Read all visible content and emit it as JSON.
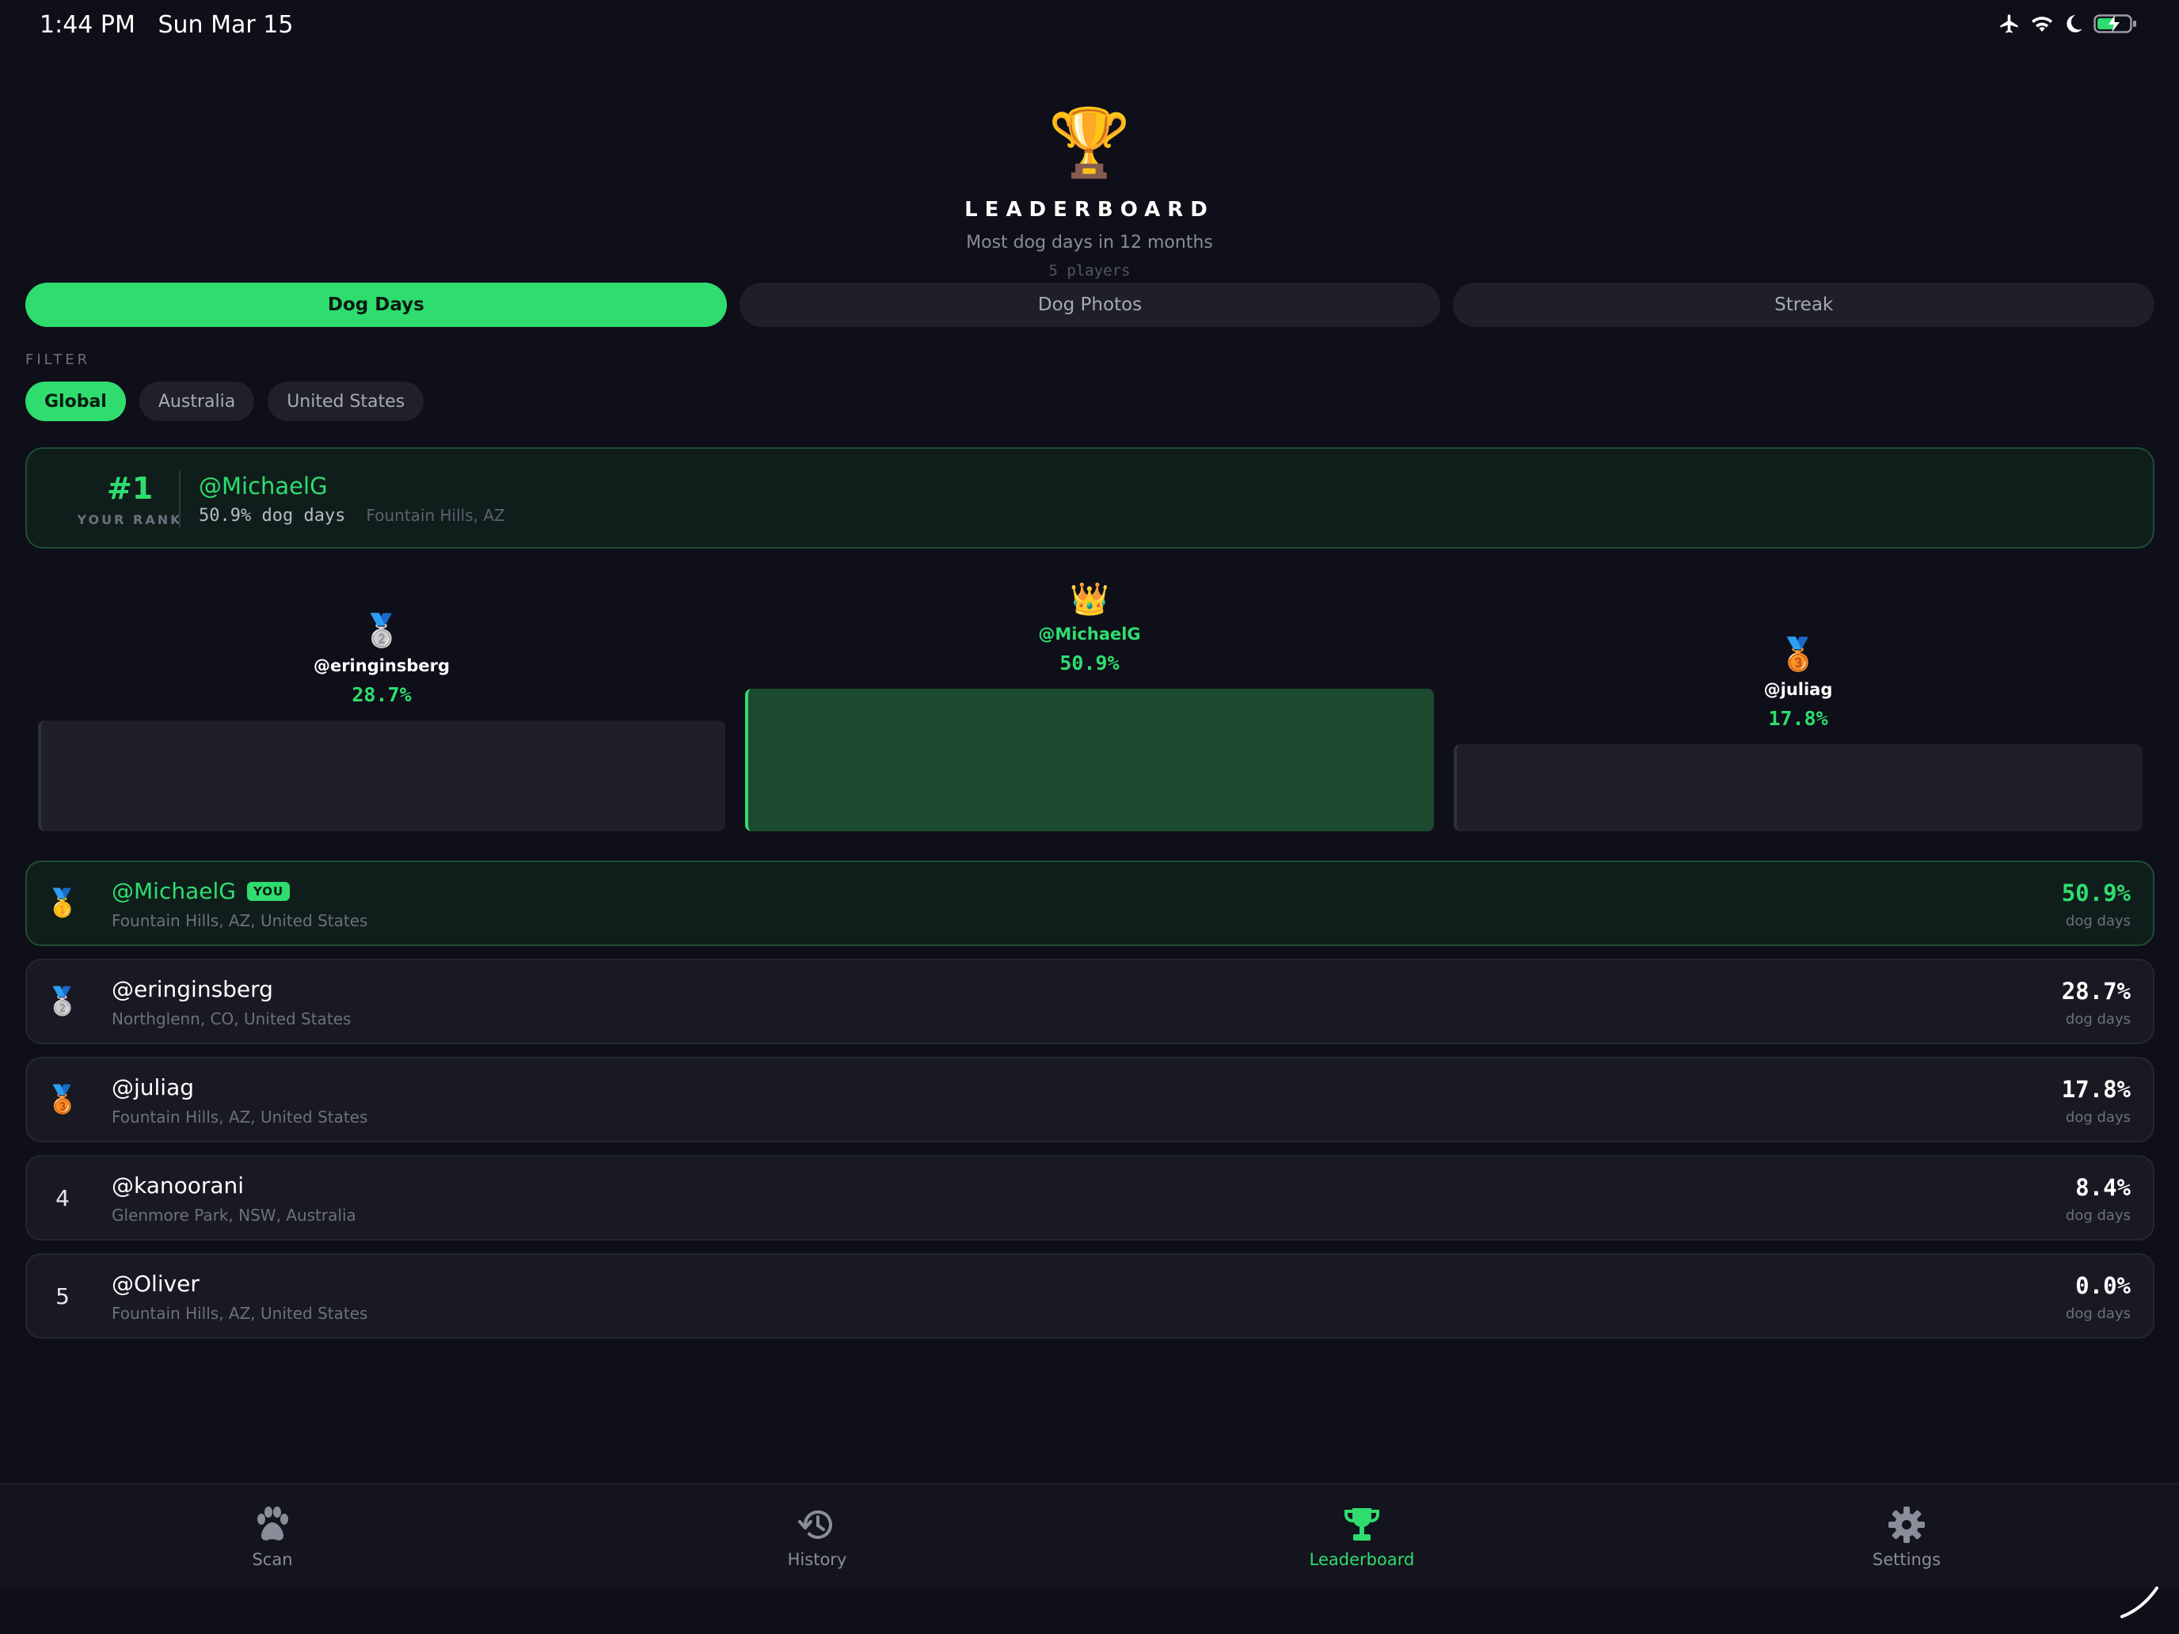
{
  "status_bar": {
    "time": "1:44 PM",
    "date": "Sun Mar 15"
  },
  "header": {
    "title": "LEADERBOARD",
    "subtitle": "Most dog days in 12 months",
    "player_count": "5 players"
  },
  "metric_tabs": [
    {
      "label": "Dog Days",
      "active": true
    },
    {
      "label": "Dog Photos",
      "active": false
    },
    {
      "label": "Streak",
      "active": false
    }
  ],
  "filter": {
    "label": "FILTER",
    "options": [
      {
        "label": "Global",
        "active": true
      },
      {
        "label": "Australia",
        "active": false
      },
      {
        "label": "United States",
        "active": false
      }
    ]
  },
  "your_rank": {
    "rank": "#1",
    "caption": "YOUR RANK",
    "username": "@MichaelG",
    "value": "50.9% dog days",
    "location": "Fountain Hills, AZ"
  },
  "podium": {
    "second": {
      "username": "@eringinsberg",
      "value": "28.7%",
      "icon": "silver-medal"
    },
    "first": {
      "username": "@MichaelG",
      "value": "50.9%",
      "icon": "crown"
    },
    "third": {
      "username": "@juliag",
      "value": "17.8%",
      "icon": "bronze-medal"
    }
  },
  "rows": [
    {
      "rank": "1",
      "medal": "gold-medal",
      "username": "@MichaelG",
      "badge": "YOU",
      "location": "Fountain Hills, AZ, United States",
      "value": "50.9%",
      "unit": "dog days"
    },
    {
      "rank": "2",
      "medal": "silver-medal",
      "username": "@eringinsberg",
      "location": "Northglenn, CO, United States",
      "value": "28.7%",
      "unit": "dog days"
    },
    {
      "rank": "3",
      "medal": "bronze-medal",
      "username": "@juliag",
      "location": "Fountain Hills, AZ, United States",
      "value": "17.8%",
      "unit": "dog days"
    },
    {
      "rank": "4",
      "username": "@kanoorani",
      "location": "Glenmore Park, NSW, Australia",
      "value": "8.4%",
      "unit": "dog days"
    },
    {
      "rank": "5",
      "username": "@Oliver",
      "location": "Fountain Hills, AZ, United States",
      "value": "0.0%",
      "unit": "dog days"
    }
  ],
  "tab_bar": [
    {
      "label": "Scan",
      "icon": "paw-icon",
      "active": false
    },
    {
      "label": "History",
      "icon": "history-icon",
      "active": false
    },
    {
      "label": "Leaderboard",
      "icon": "trophy-icon",
      "active": true
    },
    {
      "label": "Settings",
      "icon": "gear-icon",
      "active": false
    }
  ],
  "colors": {
    "accent": "#2fdd6f",
    "background": "#0e0f18",
    "card": "#181923"
  }
}
